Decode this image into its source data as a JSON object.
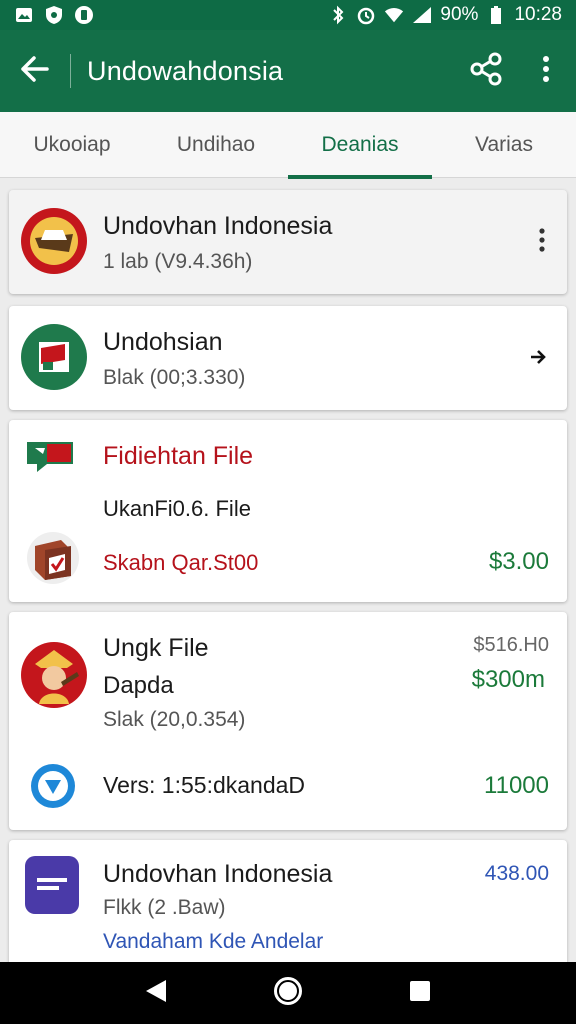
{
  "status_bar": {
    "battery_text": "90%",
    "time": "10:28",
    "left_icons": [
      "image-icon",
      "shield-icon",
      "circle-icon"
    ],
    "right_icons": [
      "bluetooth-icon",
      "alarm-icon",
      "wifi-icon",
      "signal-icon",
      "battery-icon"
    ]
  },
  "app_bar": {
    "title": "Undowahdonsia",
    "back_icon": "arrow-left-icon",
    "share_icon": "share-icon",
    "menu_icon": "more-vert-icon"
  },
  "tabs": [
    {
      "label": "Ukooiap",
      "active": false
    },
    {
      "label": "Undihao",
      "active": false
    },
    {
      "label": "Deanias",
      "active": true
    },
    {
      "label": "Varias",
      "active": false
    }
  ],
  "cards": [
    {
      "title": "Undovhan Indonesia",
      "subtitle": "1 lab (V9.4.36h)",
      "trailing_icon": "more-vert-icon"
    },
    {
      "title": "Undohsian",
      "subtitle": "Blak (00;3.330)",
      "trailing_icon": "arrow-right-icon"
    },
    {
      "header": "Fidiehtan File",
      "file_name": "UkanFi0.6. File",
      "line_label": "Skabn Qar.St00",
      "price": "$3.00"
    },
    {
      "title": "Ungk File",
      "line2": "Dapda",
      "subtitle": "Slak (20,0.354)",
      "price_top": "$516.H0",
      "price_main": "$300m",
      "version_label": "Vers: 1:55:dkandaD",
      "version_value": "11000"
    },
    {
      "title": "Undovhan Indonesia",
      "subtitle": "Flkk (2 .Baw)",
      "link": "Vandaham Kde Andelar",
      "price": "438.00"
    }
  ],
  "colors": {
    "primary": "#136f48",
    "status_bar": "#0e6b45",
    "accent_red": "#b5121b",
    "accent_green": "#1b7a3a",
    "accent_blue": "#2f55b5"
  },
  "nav_bar": {
    "icons": [
      "back-triangle-icon",
      "home-circle-icon",
      "recents-square-icon"
    ]
  }
}
